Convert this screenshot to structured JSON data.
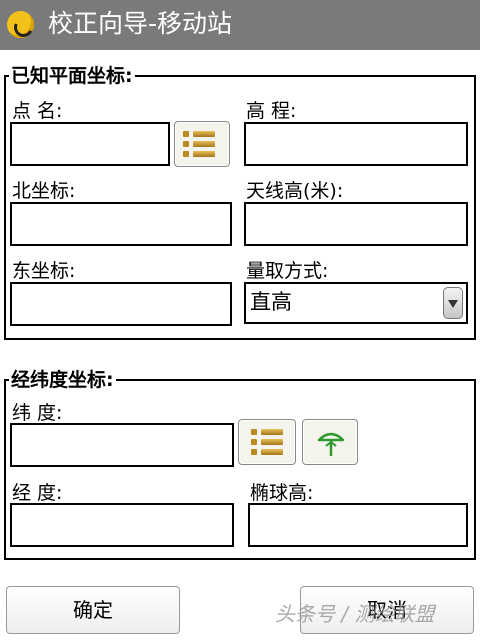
{
  "titlebar": {
    "title": "校正向导-移动站"
  },
  "plane_group": {
    "legend": "已知平面坐标:",
    "point_name_label": "点  名:",
    "point_name_value": "",
    "elevation_label": "高  程:",
    "elevation_value": "",
    "north_label": "北坐标:",
    "north_value": "",
    "antenna_label": "天线高(米):",
    "antenna_value": "",
    "east_label": "东坐标:",
    "east_value": "",
    "measure_label": "量取方式:",
    "measure_selected": "直高"
  },
  "geo_group": {
    "legend": "经纬度坐标:",
    "lat_label": "纬  度:",
    "lat_value": "",
    "lon_label": "经  度:",
    "lon_value": "",
    "ellipsoid_label": "椭球高:",
    "ellipsoid_value": ""
  },
  "buttons": {
    "ok": "确定",
    "cancel": "取消"
  },
  "watermark": "头条号 / 测绘联盟",
  "icons": {
    "app": "app-logo-icon",
    "list": "list-icon",
    "antenna": "antenna-icon"
  },
  "colors": {
    "titlebar": "#7a7a7a",
    "list_icon": "#b98a21",
    "antenna_icon": "#2e9a2e"
  }
}
